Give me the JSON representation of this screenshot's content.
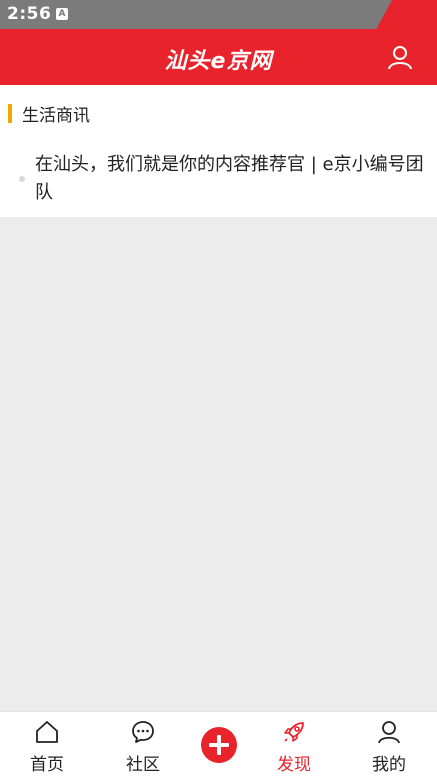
{
  "status_bar": {
    "time": "2:56",
    "notification_icon": "a-notification-icon"
  },
  "app_bar": {
    "logo_text": "汕头e京网",
    "user_icon": "user-icon"
  },
  "section": {
    "title": "生活商讯",
    "accent_color": "#f0a500"
  },
  "articles": [
    {
      "title": "在汕头，我们就是你的内容推荐官 | e京小编号团队"
    }
  ],
  "tab_bar": {
    "items": [
      {
        "label": "首页",
        "icon": "home-icon",
        "active": false
      },
      {
        "label": "社区",
        "icon": "chat-icon",
        "active": false
      },
      {
        "label": "",
        "icon": "plus-icon",
        "active": false
      },
      {
        "label": "发现",
        "icon": "rocket-icon",
        "active": true
      },
      {
        "label": "我的",
        "icon": "user-icon",
        "active": false
      }
    ]
  },
  "colors": {
    "brand": "#e8232b",
    "status_grey": "#7b7b7b",
    "background": "#ececec"
  }
}
